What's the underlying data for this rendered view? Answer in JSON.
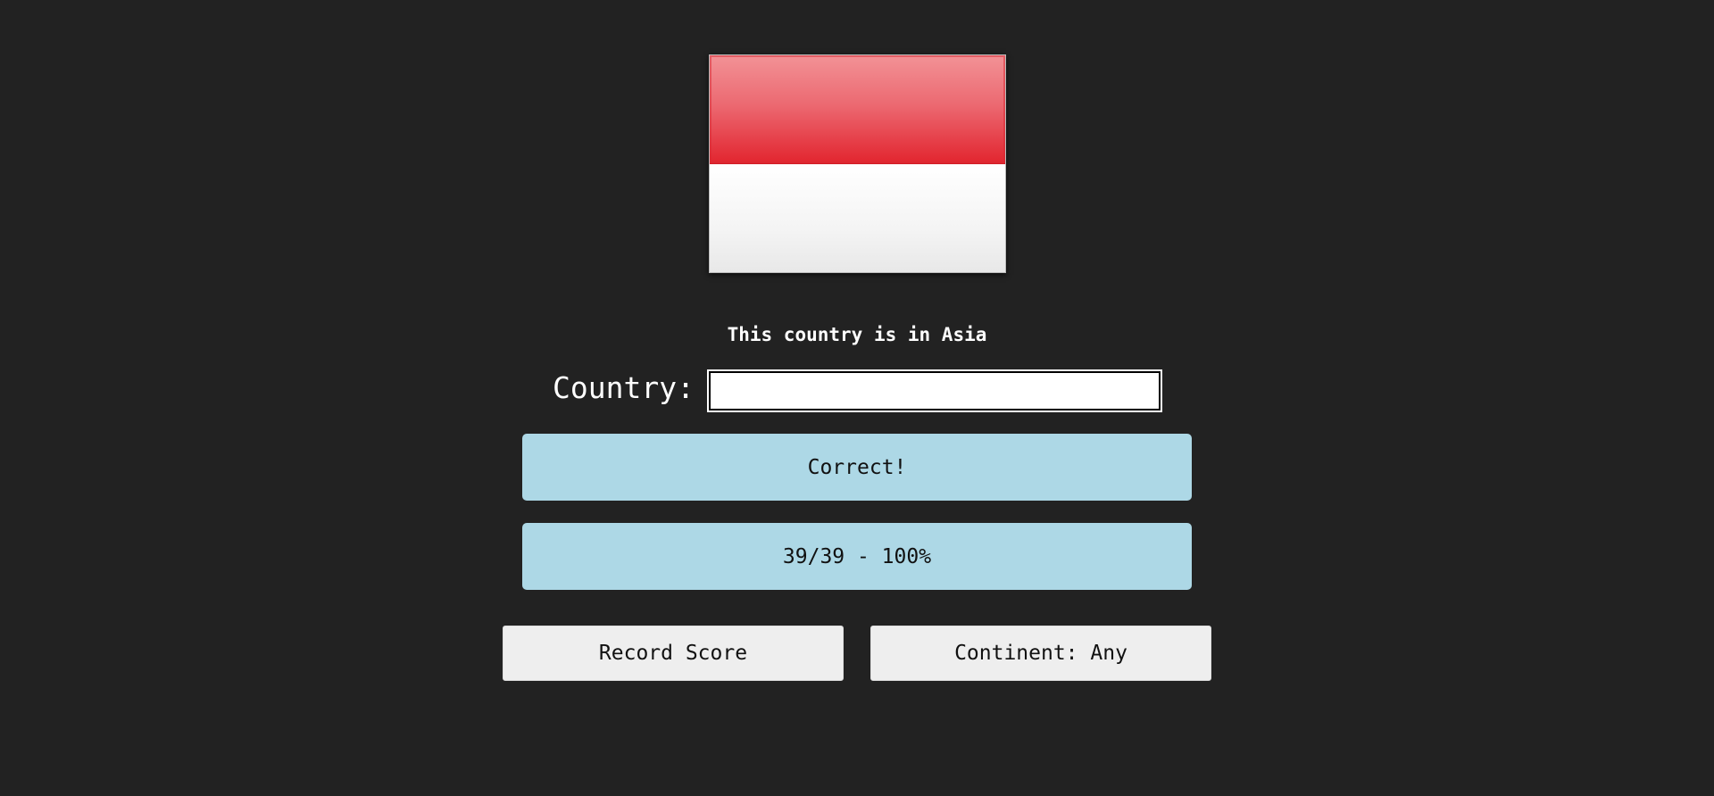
{
  "flag": {
    "icon": "flag-indonesia-icon",
    "colors": {
      "top": "#e2252f",
      "bottom": "#ffffff"
    }
  },
  "hint": "This country is in Asia",
  "country": {
    "label": "Country:",
    "value": ""
  },
  "feedback": "Correct!",
  "score": "39/39 - 100%",
  "buttons": {
    "record_score": "Record Score",
    "continent": "Continent: Any"
  },
  "colors": {
    "background": "#222222",
    "panel": "#add8e6",
    "button": "#eeeeee"
  }
}
